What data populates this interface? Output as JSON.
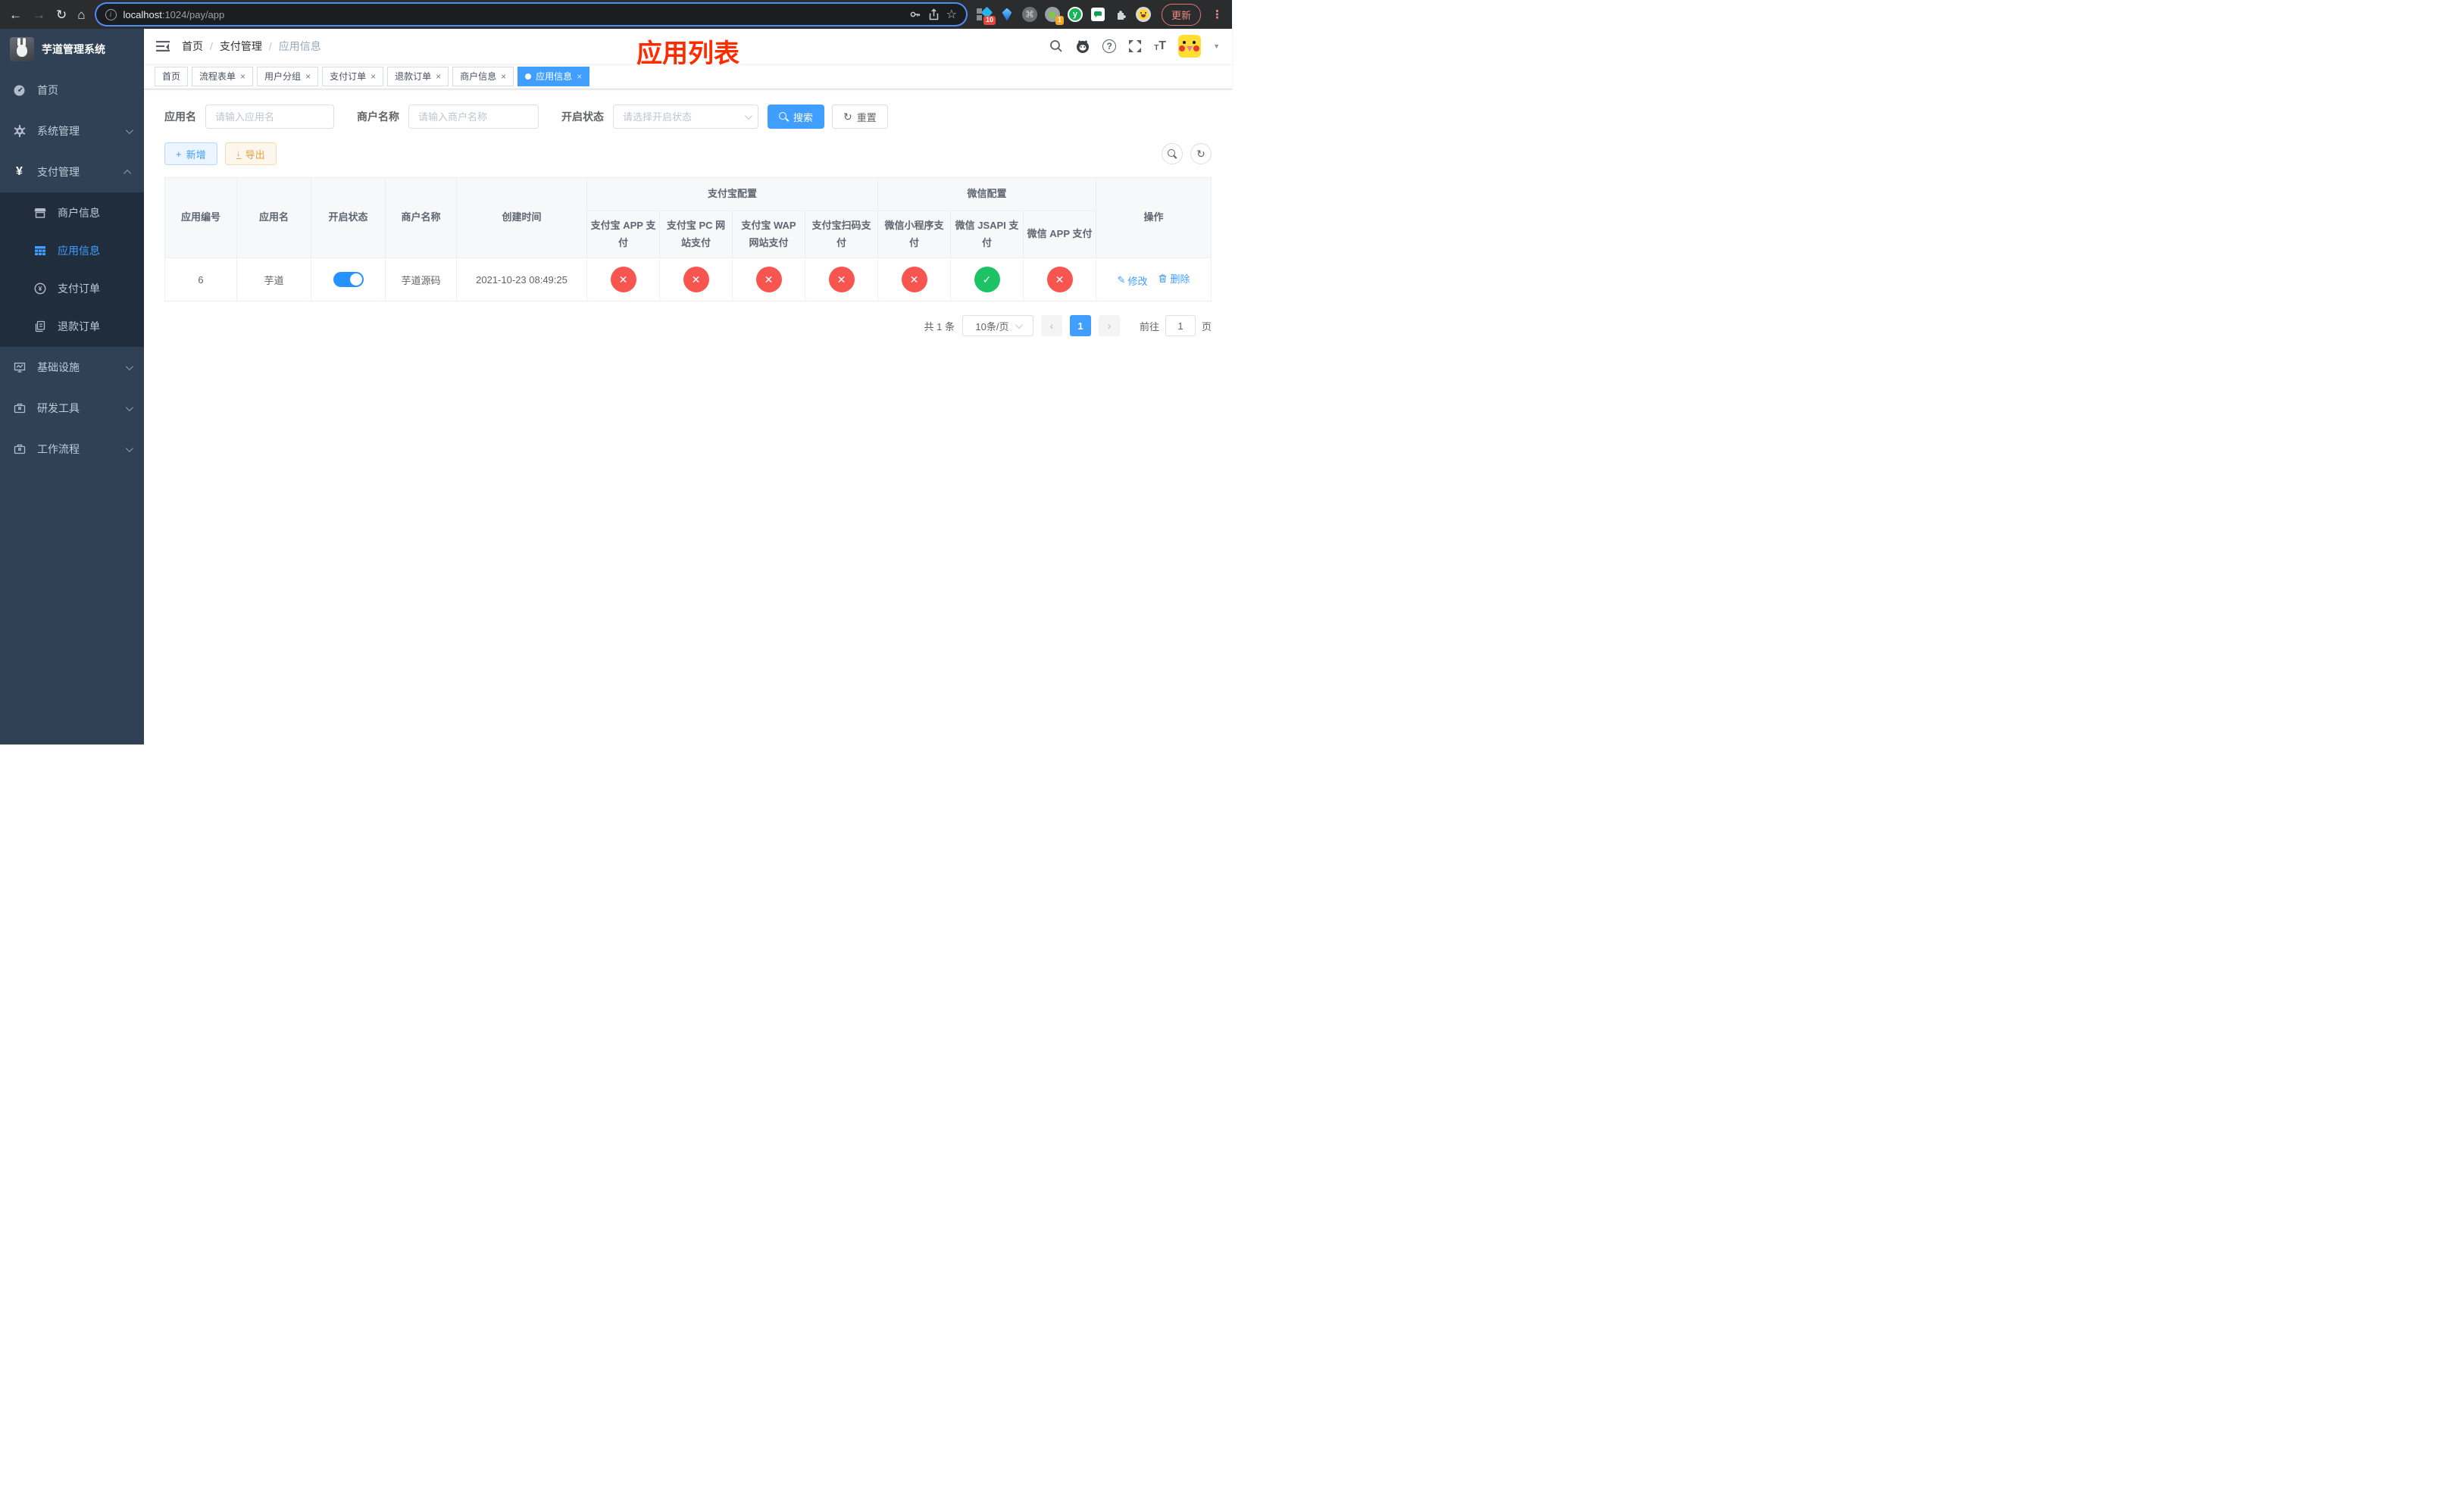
{
  "browser": {
    "url_host": "localhost",
    "url_path": ":1024/pay/app",
    "update_label": "更新",
    "badges": {
      "pin": "10",
      "proxy": "1"
    },
    "ext_y_letter": "y"
  },
  "sidebar": {
    "title": "芋道管理系统",
    "menu": [
      {
        "label": "首页"
      },
      {
        "label": "系统管理"
      },
      {
        "label": "支付管理"
      }
    ],
    "submenu": [
      {
        "label": "商户信息"
      },
      {
        "label": "应用信息"
      },
      {
        "label": "支付订单"
      },
      {
        "label": "退款订单"
      }
    ],
    "menu2": [
      {
        "label": "基础设施"
      },
      {
        "label": "研发工具"
      },
      {
        "label": "工作流程"
      }
    ]
  },
  "header": {
    "breadcrumb": [
      "首页",
      "支付管理",
      "应用信息"
    ],
    "annotation": "应用列表"
  },
  "tabs": [
    {
      "label": "首页"
    },
    {
      "label": "流程表单"
    },
    {
      "label": "用户分组"
    },
    {
      "label": "支付订单"
    },
    {
      "label": "退款订单"
    },
    {
      "label": "商户信息"
    },
    {
      "label": "应用信息"
    }
  ],
  "filters": {
    "app_name_label": "应用名",
    "app_name_placeholder": "请输入应用名",
    "merchant_label": "商户名称",
    "merchant_placeholder": "请输入商户名称",
    "status_label": "开启状态",
    "status_placeholder": "请选择开启状态",
    "search_label": "搜索",
    "reset_label": "重置"
  },
  "toolbar": {
    "add_label": "新增",
    "export_label": "导出"
  },
  "table": {
    "columns": [
      "应用编号",
      "应用名",
      "开启状态",
      "商户名称",
      "创建时间"
    ],
    "alipay_group": "支付宝配置",
    "alipay_columns": [
      "支付宝 APP 支付",
      "支付宝 PC 网站支付",
      "支付宝 WAP 网站支付",
      "支付宝扫码支付"
    ],
    "wechat_group": "微信配置",
    "wechat_columns": [
      "微信小程序支付",
      "微信 JSAPI 支付",
      "微信 APP 支付"
    ],
    "action_column": "操作",
    "row": {
      "id": "6",
      "name": "芋道",
      "enabled": true,
      "merchant": "芋道源码",
      "created": "2021-10-23 08:49:25",
      "statuses": [
        false,
        false,
        false,
        false,
        false,
        true,
        false
      ],
      "edit_label": "修改",
      "delete_label": "删除"
    }
  },
  "pagination": {
    "total_text": "共 1 条",
    "page_size": "10条/页",
    "current_page": "1",
    "goto_label": "前往",
    "goto_value": "1",
    "page_unit": "页"
  },
  "colors": {
    "primary": "#409eff",
    "success": "#1dc264",
    "danger": "#f7554f",
    "annotation": "#ff2b00",
    "sidebar_bg": "#304156",
    "submenu_bg": "#1f2d3d"
  }
}
